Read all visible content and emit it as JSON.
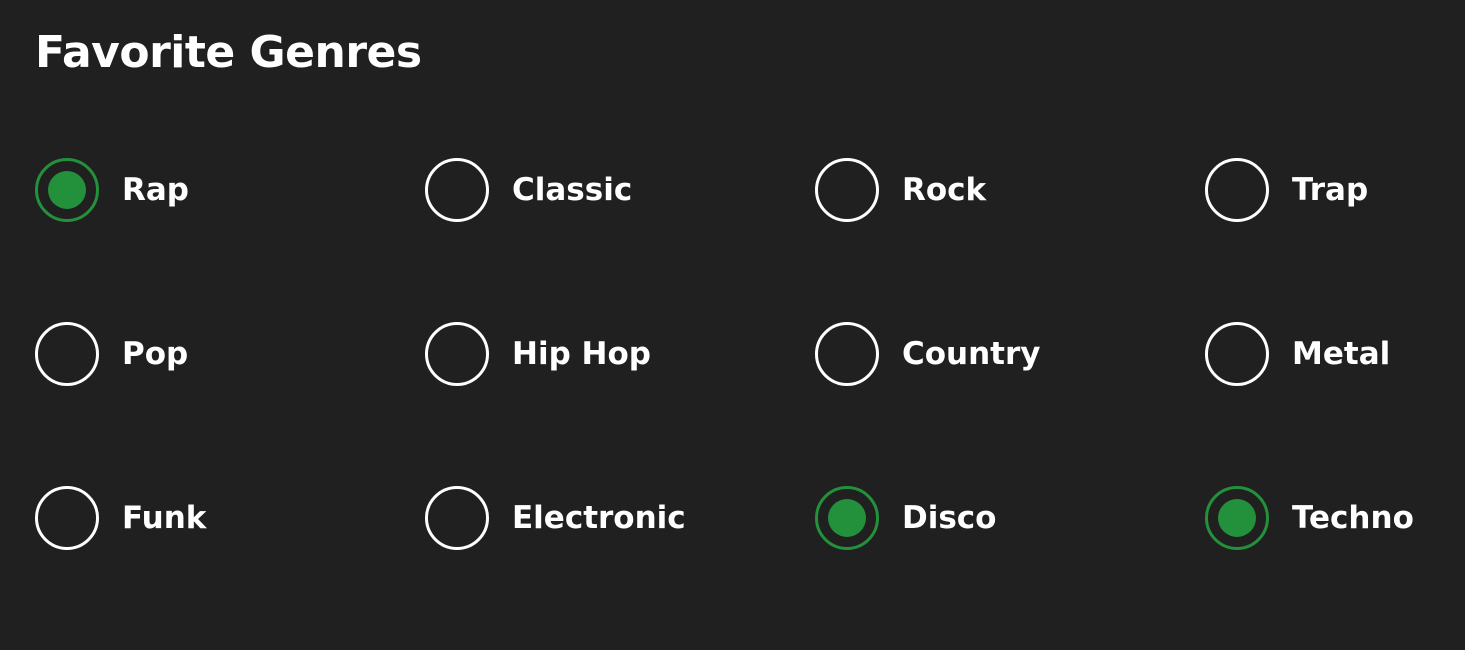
{
  "title": "Favorite Genres",
  "accent_color": "#23913c",
  "options": [
    {
      "label": "Rap",
      "checked": true
    },
    {
      "label": "Classic",
      "checked": false
    },
    {
      "label": "Rock",
      "checked": false
    },
    {
      "label": "Trap",
      "checked": false
    },
    {
      "label": "Pop",
      "checked": false
    },
    {
      "label": "Hip Hop",
      "checked": false
    },
    {
      "label": "Country",
      "checked": false
    },
    {
      "label": "Metal",
      "checked": false
    },
    {
      "label": "Funk",
      "checked": false
    },
    {
      "label": "Electronic",
      "checked": false
    },
    {
      "label": "Disco",
      "checked": true
    },
    {
      "label": "Techno",
      "checked": true
    }
  ]
}
